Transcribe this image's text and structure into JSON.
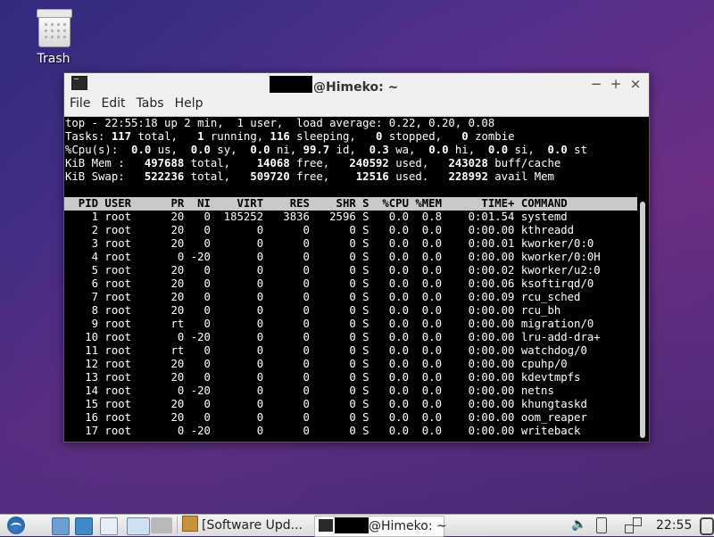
{
  "desktop": {
    "trash_label": "Trash"
  },
  "window": {
    "title_suffix": "@Himeko: ~",
    "menu": [
      "File",
      "Edit",
      "Tabs",
      "Help"
    ],
    "buttons": {
      "minimize": "−",
      "maximize": "+",
      "close": "×"
    }
  },
  "top": {
    "summary": {
      "line1": "top - 22:55:18 up 2 min,  1 user,  load average: 0.22, 0.20, 0.08",
      "tasks": {
        "label": "Tasks:",
        "total": "117",
        "running": "1",
        "sleeping": "116",
        "stopped": "0",
        "zombie": "0"
      },
      "cpu": {
        "label": "%Cpu(s):",
        "us": "0.0",
        "sy": "0.0",
        "ni": "0.0",
        "id": "99.7",
        "wa": "0.3",
        "hi": "0.0",
        "si": "0.0",
        "st": "0.0"
      },
      "mem": {
        "label": "KiB Mem :",
        "total": "497688",
        "free": "14068",
        "used": "240592",
        "buff_cache": "243028"
      },
      "swap": {
        "label": "KiB Swap:",
        "total": "522236",
        "free": "509720",
        "used": "12516",
        "avail": "228992"
      }
    },
    "columns": [
      "PID",
      "USER",
      "PR",
      "NI",
      "VIRT",
      "RES",
      "SHR",
      "S",
      "%CPU",
      "%MEM",
      "TIME+",
      "COMMAND"
    ],
    "processes": [
      [
        "1",
        "root",
        "20",
        "0",
        "185252",
        "3836",
        "2596",
        "S",
        "0.0",
        "0.8",
        "0:01.54",
        "systemd"
      ],
      [
        "2",
        "root",
        "20",
        "0",
        "0",
        "0",
        "0",
        "S",
        "0.0",
        "0.0",
        "0:00.00",
        "kthreadd"
      ],
      [
        "3",
        "root",
        "20",
        "0",
        "0",
        "0",
        "0",
        "S",
        "0.0",
        "0.0",
        "0:00.01",
        "kworker/0:0"
      ],
      [
        "4",
        "root",
        "0",
        "-20",
        "0",
        "0",
        "0",
        "S",
        "0.0",
        "0.0",
        "0:00.00",
        "kworker/0:0H"
      ],
      [
        "5",
        "root",
        "20",
        "0",
        "0",
        "0",
        "0",
        "S",
        "0.0",
        "0.0",
        "0:00.02",
        "kworker/u2:0"
      ],
      [
        "6",
        "root",
        "20",
        "0",
        "0",
        "0",
        "0",
        "S",
        "0.0",
        "0.0",
        "0:00.06",
        "ksoftirqd/0"
      ],
      [
        "7",
        "root",
        "20",
        "0",
        "0",
        "0",
        "0",
        "S",
        "0.0",
        "0.0",
        "0:00.09",
        "rcu_sched"
      ],
      [
        "8",
        "root",
        "20",
        "0",
        "0",
        "0",
        "0",
        "S",
        "0.0",
        "0.0",
        "0:00.00",
        "rcu_bh"
      ],
      [
        "9",
        "root",
        "rt",
        "0",
        "0",
        "0",
        "0",
        "S",
        "0.0",
        "0.0",
        "0:00.00",
        "migration/0"
      ],
      [
        "10",
        "root",
        "0",
        "-20",
        "0",
        "0",
        "0",
        "S",
        "0.0",
        "0.0",
        "0:00.00",
        "lru-add-dra+"
      ],
      [
        "11",
        "root",
        "rt",
        "0",
        "0",
        "0",
        "0",
        "S",
        "0.0",
        "0.0",
        "0:00.00",
        "watchdog/0"
      ],
      [
        "12",
        "root",
        "20",
        "0",
        "0",
        "0",
        "0",
        "S",
        "0.0",
        "0.0",
        "0:00.00",
        "cpuhp/0"
      ],
      [
        "13",
        "root",
        "20",
        "0",
        "0",
        "0",
        "0",
        "S",
        "0.0",
        "0.0",
        "0:00.00",
        "kdevtmpfs"
      ],
      [
        "14",
        "root",
        "0",
        "-20",
        "0",
        "0",
        "0",
        "S",
        "0.0",
        "0.0",
        "0:00.00",
        "netns"
      ],
      [
        "15",
        "root",
        "20",
        "0",
        "0",
        "0",
        "0",
        "S",
        "0.0",
        "0.0",
        "0:00.00",
        "khungtaskd"
      ],
      [
        "16",
        "root",
        "20",
        "0",
        "0",
        "0",
        "0",
        "S",
        "0.0",
        "0.0",
        "0:00.00",
        "oom_reaper"
      ],
      [
        "17",
        "root",
        "0",
        "-20",
        "0",
        "0",
        "0",
        "S",
        "0.0",
        "0.0",
        "0:00.00",
        "writeback"
      ]
    ]
  },
  "taskbar": {
    "tasks": [
      {
        "label": "[Software Upd...",
        "icon": "package-icon"
      },
      {
        "label": "@Himeko: ~",
        "icon": "terminal-icon"
      }
    ],
    "clock": "22:55"
  }
}
